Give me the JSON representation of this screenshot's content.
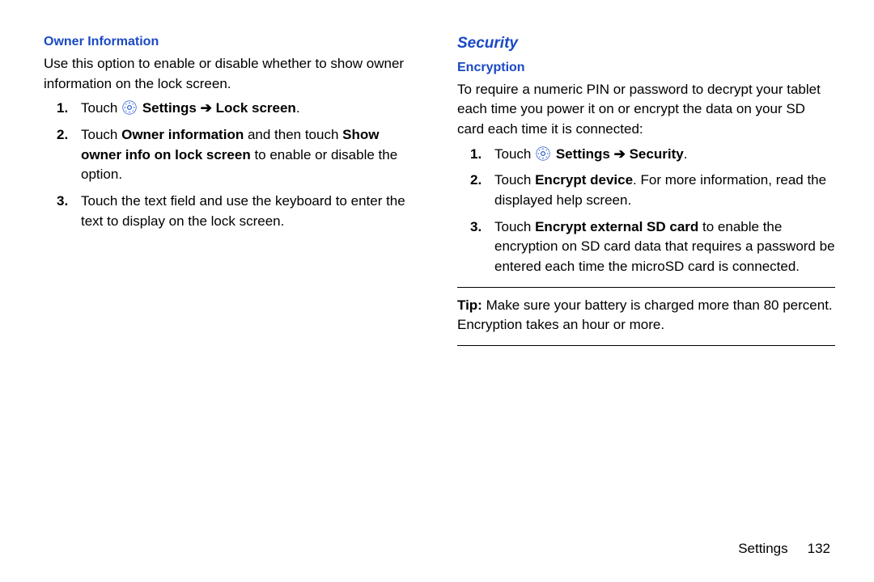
{
  "left": {
    "heading": "Owner Information",
    "intro": "Use this option to enable or disable whether to show owner information on the lock screen.",
    "steps": [
      {
        "pre": "Touch ",
        "icon": true,
        "bold1": "Settings",
        "arrow": " ➔ ",
        "bold2": "Lock screen",
        "post": "."
      },
      {
        "pre": "Touch ",
        "bold1": "Owner information",
        "mid1": " and then touch ",
        "bold2": "Show owner info on lock screen",
        "post": " to enable or disable the option."
      },
      {
        "plain": "Touch the text field and use the keyboard to enter the text to display on the lock screen."
      }
    ]
  },
  "right": {
    "section": "Security",
    "subsection": "Encryption",
    "intro": "To require a numeric PIN or password to decrypt your tablet each time you power it on or encrypt the data on your SD card each time it is connected:",
    "steps": [
      {
        "pre": "Touch ",
        "icon": true,
        "bold1": "Settings",
        "arrow": " ➔ ",
        "bold2": "Security",
        "post": "."
      },
      {
        "pre": "Touch ",
        "bold1": "Encrypt device",
        "post": ". For more information, read the displayed help screen."
      },
      {
        "pre": "Touch ",
        "bold1": "Encrypt external SD card",
        "post": " to enable the encryption on SD card data that requires a password be entered each time the microSD card is connected."
      }
    ],
    "tip_label": "Tip:",
    "tip_text": " Make sure your battery is charged more than 80 percent. Encryption takes an hour or more."
  },
  "footer": {
    "section": "Settings",
    "page": "132"
  }
}
